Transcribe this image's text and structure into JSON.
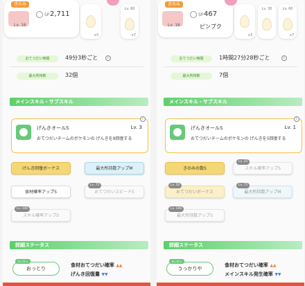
{
  "left": {
    "name_tag": "きのみ",
    "sp_label": "SP",
    "sp_value": "2,711",
    "level": "Lv. 16",
    "eggs": [
      {
        "level": "",
        "count": "x3"
      },
      {
        "level": "Lv. 60",
        "count": "x7"
      }
    ],
    "stats": [
      {
        "label": "おてつだい時間",
        "value": "49分3秒ごと"
      },
      {
        "label": "最大所持数",
        "value": "32個"
      }
    ],
    "section_skill": "メインスキル・サブスキル",
    "main_skill": {
      "name": "げんきオールS",
      "level": "Lv. 3",
      "desc": "おてつだいチームのポケモンの げんきを9回復する"
    },
    "sub_skills": [
      {
        "label": "げんき回復ボーナス",
        "lv": ""
      },
      {
        "label": "最大所持数アップM",
        "lv": ""
      },
      {
        "label": "食材確率アップS",
        "lv": ""
      },
      {
        "label": "おてつだいスピードS",
        "lv": "Lv. 75"
      },
      {
        "label": "スキル確率アップS",
        "lv": "Lv. 100"
      }
    ],
    "section_detail": "詳細ステータス",
    "nature_tag": "せいかく",
    "nature": "おっとり",
    "effects": [
      {
        "text": "食材おてつだい確率",
        "arrows": "▲▲",
        "dir": "up"
      },
      {
        "text": "げんき回復量",
        "arrows": "▼▼",
        "dir": "down"
      }
    ]
  },
  "right": {
    "name_tag": "きのみ",
    "sp_label": "SP",
    "sp_value": "467",
    "level": "Lv. 16",
    "nickname": "ピンプク",
    "eggs": [
      {
        "level": "Lv. 30",
        "count": "x3"
      },
      {
        "level": "Lv. 60",
        "count": "x7"
      }
    ],
    "stats": [
      {
        "label": "おてつだい時間",
        "value": "1時間27分28秒ごと"
      },
      {
        "label": "最大所持数",
        "value": "7個"
      }
    ],
    "section_skill": "メインスキル・サブスキル",
    "main_skill": {
      "name": "げんきオールS",
      "level": "Lv. 1",
      "desc": "おてつだいチームのポケモンの げんきを5回復する"
    },
    "sub_skills": [
      {
        "label": "きのみの数S",
        "lv": ""
      },
      {
        "label": "スキル確率アップS",
        "lv": "Lv. 25"
      },
      {
        "label": "おてつだいボーナス",
        "lv": "Lv. 50"
      },
      {
        "label": "最大所持数アップM",
        "lv": "Lv. 75"
      },
      {
        "label": "最大所持数アップS",
        "lv": "Lv. 100"
      }
    ],
    "section_detail": "詳細ステータス",
    "nature_tag": "せいかく",
    "nature": "うっかりや",
    "effects": [
      {
        "text": "食材おてつだい確率",
        "arrows": "▲▲",
        "dir": "up"
      },
      {
        "text": "メインスキル発生確率",
        "arrows": "▼▼",
        "dir": "down"
      }
    ]
  }
}
